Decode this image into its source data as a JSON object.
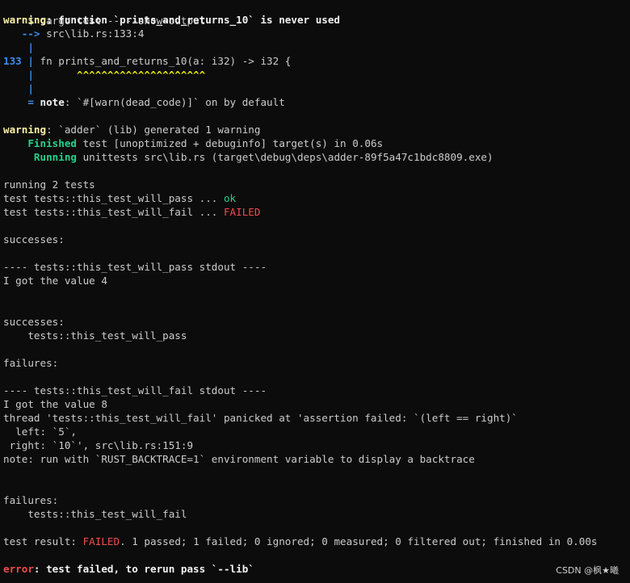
{
  "cmd": "$ cargo test -- --show-output",
  "warn1": {
    "label": "warning",
    "msg": ": function `prints_and_returns_10` is never used",
    "arrow": "   -->",
    "loc": " src\\lib.rs:133:4",
    "pipe": "    |",
    "lineno": "133",
    "pipe_sep": " |",
    "code": " fn prints_and_returns_10(a: i32) -> i32 {",
    "pipe_pad": "    |",
    "carets": "       ^^^^^^^^^^^^^^^^^^^^^",
    "note_eq": "    =",
    "note_label": " note",
    "note_msg": ": `#[warn(dead_code)]` on by default"
  },
  "warn2": {
    "label": "warning",
    "msg": ": `adder` (lib) generated 1 warning"
  },
  "finished": {
    "label": "    Finished",
    "msg": " test [unoptimized + debuginfo] target(s) in 0.06s"
  },
  "running_unit": {
    "label": "     Running",
    "msg": " unittests src\\lib.rs (target\\debug\\deps\\adder-89f5a47c1bdc8809.exe)"
  },
  "running_count": "running 2 tests",
  "test_pass": {
    "prefix": "test tests::this_test_will_pass ... ",
    "status": "ok"
  },
  "test_fail": {
    "prefix": "test tests::this_test_will_fail ... ",
    "status": "FAILED"
  },
  "successes_header": "successes:",
  "pass_stdout_header": "---- tests::this_test_will_pass stdout ----",
  "pass_stdout_value": "I got the value 4",
  "successes_header2": "successes:",
  "successes_item": "    tests::this_test_will_pass",
  "failures_header": "failures:",
  "fail_stdout_header": "---- tests::this_test_will_fail stdout ----",
  "fail_stdout_value": "I got the value 8",
  "panic_line": "thread 'tests::this_test_will_fail' panicked at 'assertion failed: `(left == right)`",
  "panic_left": "  left: `5`,",
  "panic_right": " right: `10`', src\\lib.rs:151:9",
  "panic_note": "note: run with `RUST_BACKTRACE=1` environment variable to display a backtrace",
  "failures_header2": "failures:",
  "failures_item": "    tests::this_test_will_fail",
  "result": {
    "prefix": "test result: ",
    "status": "FAILED",
    "rest": ". 1 passed; 1 failed; 0 ignored; 0 measured; 0 filtered out; finished in 0.00s"
  },
  "error": {
    "label": "error",
    "msg": ": test failed, to rerun pass `--lib`"
  },
  "watermark": "CSDN @枫★曦"
}
